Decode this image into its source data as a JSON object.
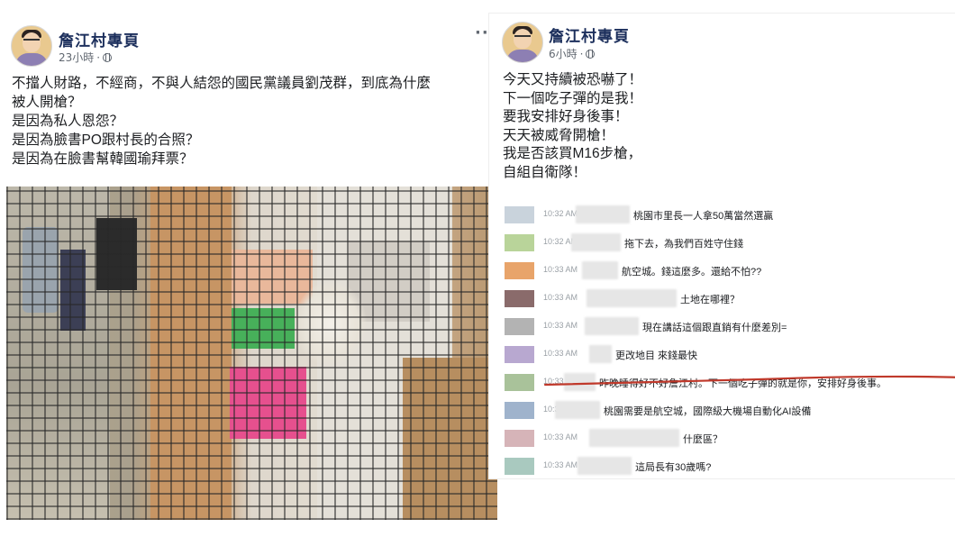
{
  "left_post": {
    "page_name": "詹江村專頁",
    "time": "23小時",
    "more": "···",
    "text": "不擋人財路，不經商，不與人結怨的國民黨議員劉茂群，到底為什麼\n被人開槍？\n是因為私人恩怨？\n是因為臉書PO跟村長的合照？\n是因為在臉書幫韓國瑜拜票？"
  },
  "right_post": {
    "page_name": "詹江村專頁",
    "time": "6小時",
    "text": "今天又持續被恐嚇了！\n下一個吃子彈的是我！\n要我安排好身後事！\n天天被威脅開槍！\n我是否該買M16步槍，\n自組自衛隊！"
  },
  "chat_rows": [
    {
      "time": "10:32 AM",
      "message": "桃園市里長一人拿50萬當然選贏",
      "avatar_color": "#c9d3dc"
    },
    {
      "time": "10:32 AM",
      "message": "拖下去，為我們百姓守住錢",
      "avatar_color": "#b9d49a"
    },
    {
      "time": "10:33 AM",
      "message": "航空城。錢這麼多。還給不怕??",
      "avatar_color": "#e8a46a"
    },
    {
      "time": "10:33 AM",
      "message": "土地在哪裡？",
      "avatar_color": "#8a6b6b"
    },
    {
      "time": "10:33 AM",
      "message": "現在講話這個跟直銷有什麼差別=",
      "avatar_color": "#b3b3b3"
    },
    {
      "time": "10:33 AM",
      "message": "更改地目 來錢最快",
      "avatar_color": "#b8a8d0"
    },
    {
      "time": "10:33 AM",
      "message": "昨晚睡得好不好詹江村。下一個吃子彈的就是你，安排好身後事。",
      "avatar_color": "#a9c29a"
    },
    {
      "time": "10:33 AM",
      "message": "桃園需要是航空城，國際級大機場自動化AI設備",
      "avatar_color": "#9fb3cc"
    },
    {
      "time": "10:33 AM",
      "message": "什麼區？",
      "avatar_color": "#d6b4b8"
    },
    {
      "time": "10:33 AM",
      "message": "這局長有30歲嗎?",
      "avatar_color": "#a9c9bf"
    }
  ],
  "colors": {
    "underline": "#c0392b",
    "page_name": "#1c2f5c",
    "meta": "#606770"
  }
}
